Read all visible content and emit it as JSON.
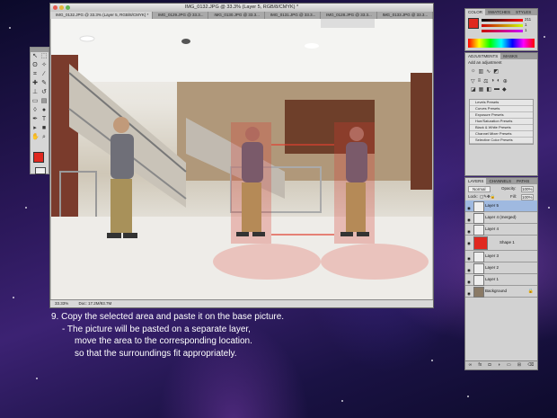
{
  "document": {
    "title": "IMG_0132.JPG @ 33.3% (Layer 5, RGB/8/CMYK) *",
    "tabs": [
      "IMG_0132.JPG @ 33.3% (Layer 5, RGB/8/CMYK) *",
      "IMG_0129.JPG @ 33.3...",
      "IMG_0130.JPG @ 33.3...",
      "IMG_0131.JPG @ 33.3...",
      "IMG_0128.JPG @ 33.3...",
      "IMG_0133.JPG @ 33.3..."
    ],
    "zoom": "33.33%",
    "doc_size": "Doc: 17.2M/93.7M"
  },
  "panels": {
    "color_tabs": [
      "COLOR",
      "SWATCHES",
      "STYLES"
    ],
    "color_values": {
      "r": "211",
      "g": "1",
      "b": "1"
    },
    "adjust_tabs": [
      "ADJUSTMENTS",
      "MASKS"
    ],
    "adjust_hint": "Add an adjustment",
    "presets": [
      "Levels Presets",
      "Curves Presets",
      "Exposure Presets",
      "Hue/Saturation Presets",
      "Black & White Presets",
      "Channel Mixer Presets",
      "Selective Color Presets"
    ],
    "layers_tabs": [
      "LAYERS",
      "CHANNELS",
      "PATHS"
    ],
    "blend_mode": "Normal",
    "opacity_label": "Opacity:",
    "opacity_value": "100%",
    "lock_label": "Lock:",
    "fill_label": "Fill:",
    "fill_value": "100%",
    "layers": [
      "Layer 5",
      "Layer 4 (merged)",
      "Layer 4",
      "Shape 1",
      "Layer 3",
      "Layer 2",
      "Layer 1",
      "Background"
    ]
  },
  "caption": {
    "line1": "9. Copy the selected area and paste it on the base picture.",
    "line2": "- The picture will be pasted on a separate layer,",
    "line3": "move the area to the corresponding location.",
    "line4": "so that the surroundings fit appropriately."
  },
  "colors": {
    "foreground": "#e0281f",
    "selection_tint": "#d93a2e"
  },
  "icons": {
    "tools": [
      "move-icon",
      "marquee-icon",
      "lasso-icon",
      "wand-icon",
      "crop-icon",
      "eyedropper-icon",
      "heal-icon",
      "brush-icon",
      "stamp-icon",
      "history-brush-icon",
      "eraser-icon",
      "gradient-icon",
      "blur-icon",
      "dodge-icon",
      "pen-icon",
      "type-icon",
      "path-select-icon",
      "shape-icon",
      "hand-icon",
      "zoom-icon"
    ]
  }
}
